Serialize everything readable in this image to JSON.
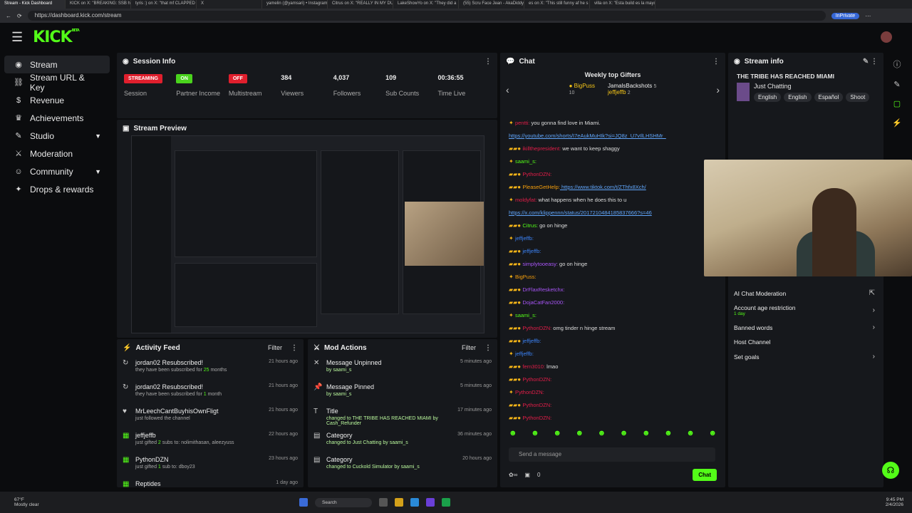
{
  "browser": {
    "tabs": [
      "Stream - Kick Dashboard",
      "KICK on X: \"BREAKING: SSB has a",
      "tyris :) on X: \"that mf CLAPPED",
      "X",
      "yamelin (@yamsari) • Instagram",
      "Citrus on X: \"REALLY IN MY DUI",
      "LakeShowYo on X: \"They did a",
      "(55) Scru Face Jean - AkaDiddy",
      "es on X: \"This still funny af he s",
      "villa on X: \"Esta build es la mayor"
    ],
    "url": "https://dashboard.kick.com/stream",
    "inprivate": "InPrivate"
  },
  "header": {
    "logo": "KICK",
    "beta": "BETA"
  },
  "sidebar": {
    "items": [
      {
        "label": "Stream",
        "icon": "broadcast-icon"
      },
      {
        "label": "Stream URL & Key",
        "icon": "link-icon"
      },
      {
        "label": "Revenue",
        "icon": "dollar-icon"
      },
      {
        "label": "Achievements",
        "icon": "trophy-icon"
      },
      {
        "label": "Studio",
        "icon": "palette-icon"
      },
      {
        "label": "Moderation",
        "icon": "sword-icon"
      },
      {
        "label": "Community",
        "icon": "community-icon"
      },
      {
        "label": "Drops & rewards",
        "icon": "gift-icon"
      }
    ]
  },
  "session": {
    "title": "Session Info",
    "streaming": "STREAMING",
    "session_label": "Session",
    "on": "ON",
    "partner": "Partner Income",
    "off": "OFF",
    "multistream": "Multistream",
    "viewers": "384",
    "viewers_label": "Viewers",
    "followers": "4,037",
    "followers_label": "Followers",
    "subs": "109",
    "subs_label": "Sub Counts",
    "time": "00:36:55",
    "time_label": "Time Live"
  },
  "preview": {
    "title": "Stream Preview"
  },
  "activity": {
    "title": "Activity Feed",
    "filter": "Filter",
    "items": [
      {
        "title": "jordan02 Resubscribed!",
        "pre": "they have been subscribed for ",
        "hl": "25",
        "post": " months",
        "time": "21 hours ago"
      },
      {
        "title": "jordan02 Resubscribed!",
        "pre": "they have been subscribed for ",
        "hl": "1",
        "post": " month",
        "time": "21 hours ago"
      },
      {
        "title": "MrLeechCantBuyhisOwnFligt",
        "pre": "just followed the channel",
        "hl": "",
        "post": "",
        "time": "21 hours ago"
      },
      {
        "title": "jeffjeffb",
        "pre": "just gifted ",
        "hl": "2",
        "post": " subs to: nolimithasan, aleezyuss",
        "time": "22 hours ago"
      },
      {
        "title": "PythonDZN",
        "pre": "just gifted ",
        "hl": "1",
        "post": " sub to: dboy23",
        "time": "23 hours ago"
      },
      {
        "title": "Reptides",
        "pre": "",
        "hl": "",
        "post": "",
        "time": "1 day ago"
      }
    ]
  },
  "mod": {
    "title": "Mod Actions",
    "filter": "Filter",
    "items": [
      {
        "title": "Message Unpinned",
        "sub": "by saami_s",
        "time": "5 minutes ago"
      },
      {
        "title": "Message Pinned",
        "sub": "by saami_s",
        "time": "5 minutes ago"
      },
      {
        "title": "Title",
        "sub": "changed to THE TRIBE HAS REACHED MIAMI by Cash_Refunder",
        "time": "17 minutes ago"
      },
      {
        "title": "Category",
        "sub": "changed to Just Chatting by saami_s",
        "time": "36 minutes ago"
      },
      {
        "title": "Category",
        "sub": "changed to Cuckold Simulator by saami_s",
        "time": "20 hours ago"
      }
    ]
  },
  "chat": {
    "title": "Chat",
    "gifters_title": "Weekly top Gifters",
    "g1": "BigPuss",
    "g1n": "10",
    "g2": "JamalsBackshots",
    "g2n": "5",
    "g3": "jeffjeffb",
    "g3n": "2",
    "messages": [
      {
        "user": "pentti:",
        "cls": "u-red",
        "text": " you gonna find love in Miami."
      },
      {
        "user": "",
        "cls": "u-white",
        "text": "https://youtube.com/shorts/I7eAukMuHIk?si=JQ8z_U7vIlLHSHMr_",
        "link": true
      },
      {
        "user": "ikillthepresident:",
        "cls": "u-red",
        "text": " we want to keep shaggy"
      },
      {
        "user": "saami_s:",
        "cls": "u-green",
        "text": ""
      },
      {
        "user": "PythonDZN:",
        "cls": "u-red",
        "text": ""
      },
      {
        "user": "PleaseGetHelp:",
        "cls": "u-orange",
        "text": " https://www.tiktok.com/t/ZThfx8Xch/",
        "link": true
      },
      {
        "user": "moldyfat:",
        "cls": "u-red",
        "text": " what happens when he does this to u"
      },
      {
        "user": "",
        "cls": "u-white",
        "text": "https://x.com/klippennn/status/2017210484185837666?s=46",
        "link": true
      },
      {
        "user": "Citrus:",
        "cls": "u-green",
        "text": " go on hinge"
      },
      {
        "user": "jeffjeffb:",
        "cls": "u-blue",
        "text": ""
      },
      {
        "user": "jeffjeffb:",
        "cls": "u-blue",
        "text": ""
      },
      {
        "user": "simplytooeasy:",
        "cls": "u-purple",
        "text": " go on hinge"
      },
      {
        "user": "BigPuss:",
        "cls": "u-orange",
        "text": ""
      },
      {
        "user": "DrFlaxResketchx:",
        "cls": "u-purple",
        "text": ""
      },
      {
        "user": "DojaCatFan2000:",
        "cls": "u-purple",
        "text": ""
      },
      {
        "user": "saami_s:",
        "cls": "u-green",
        "text": ""
      },
      {
        "user": "PythonDZN:",
        "cls": "u-red",
        "text": " omg tinder n hinge stream"
      },
      {
        "user": "jeffjeffb:",
        "cls": "u-blue",
        "text": ""
      },
      {
        "user": "jeffjeffb:",
        "cls": "u-blue",
        "text": ""
      },
      {
        "user": "fern3010:",
        "cls": "u-red",
        "text": " lmao"
      },
      {
        "user": "PythonDZN:",
        "cls": "u-red",
        "text": ""
      },
      {
        "user": "PythonDZN:",
        "cls": "u-red",
        "text": ""
      },
      {
        "user": "PythonDZN:",
        "cls": "u-red",
        "text": ""
      },
      {
        "user": "PythonDZN:",
        "cls": "u-red",
        "text": ""
      }
    ],
    "placeholder": "Send a message",
    "points": "0",
    "send": "Chat"
  },
  "streaminfo": {
    "title": "Stream info",
    "stream_title": "THE TRIBE HAS REACHED MIAMI",
    "category": "Just Chatting",
    "tags": [
      "English",
      "English",
      "Español",
      "Shoot"
    ]
  },
  "settings": [
    {
      "label": "AI Chat Moderation",
      "sub": ""
    },
    {
      "label": "Account age restriction",
      "sub": "1 day"
    },
    {
      "label": "Banned words",
      "sub": ""
    },
    {
      "label": "Host Channel",
      "sub": ""
    },
    {
      "label": "Set goals",
      "sub": ""
    }
  ],
  "taskbar": {
    "temp": "67°F",
    "weather": "Mostly clear",
    "search": "Search",
    "time": "9:45 PM",
    "date": "2/4/2026"
  }
}
